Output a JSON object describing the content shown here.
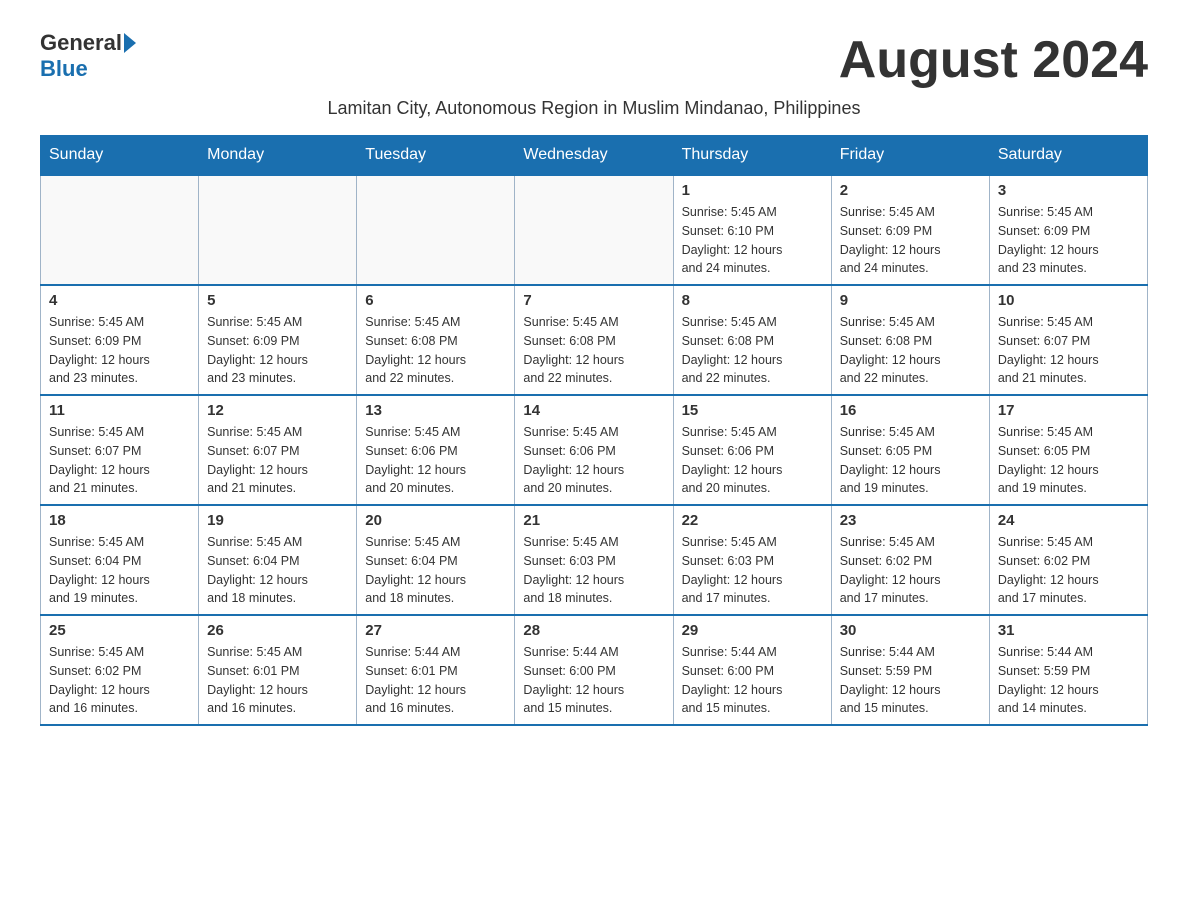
{
  "header": {
    "logo_general": "General",
    "logo_blue": "Blue",
    "month_title": "August 2024",
    "subtitle": "Lamitan City, Autonomous Region in Muslim Mindanao, Philippines"
  },
  "weekdays": [
    "Sunday",
    "Monday",
    "Tuesday",
    "Wednesday",
    "Thursday",
    "Friday",
    "Saturday"
  ],
  "weeks": [
    [
      {
        "day": "",
        "info": ""
      },
      {
        "day": "",
        "info": ""
      },
      {
        "day": "",
        "info": ""
      },
      {
        "day": "",
        "info": ""
      },
      {
        "day": "1",
        "info": "Sunrise: 5:45 AM\nSunset: 6:10 PM\nDaylight: 12 hours\nand 24 minutes."
      },
      {
        "day": "2",
        "info": "Sunrise: 5:45 AM\nSunset: 6:09 PM\nDaylight: 12 hours\nand 24 minutes."
      },
      {
        "day": "3",
        "info": "Sunrise: 5:45 AM\nSunset: 6:09 PM\nDaylight: 12 hours\nand 23 minutes."
      }
    ],
    [
      {
        "day": "4",
        "info": "Sunrise: 5:45 AM\nSunset: 6:09 PM\nDaylight: 12 hours\nand 23 minutes."
      },
      {
        "day": "5",
        "info": "Sunrise: 5:45 AM\nSunset: 6:09 PM\nDaylight: 12 hours\nand 23 minutes."
      },
      {
        "day": "6",
        "info": "Sunrise: 5:45 AM\nSunset: 6:08 PM\nDaylight: 12 hours\nand 22 minutes."
      },
      {
        "day": "7",
        "info": "Sunrise: 5:45 AM\nSunset: 6:08 PM\nDaylight: 12 hours\nand 22 minutes."
      },
      {
        "day": "8",
        "info": "Sunrise: 5:45 AM\nSunset: 6:08 PM\nDaylight: 12 hours\nand 22 minutes."
      },
      {
        "day": "9",
        "info": "Sunrise: 5:45 AM\nSunset: 6:08 PM\nDaylight: 12 hours\nand 22 minutes."
      },
      {
        "day": "10",
        "info": "Sunrise: 5:45 AM\nSunset: 6:07 PM\nDaylight: 12 hours\nand 21 minutes."
      }
    ],
    [
      {
        "day": "11",
        "info": "Sunrise: 5:45 AM\nSunset: 6:07 PM\nDaylight: 12 hours\nand 21 minutes."
      },
      {
        "day": "12",
        "info": "Sunrise: 5:45 AM\nSunset: 6:07 PM\nDaylight: 12 hours\nand 21 minutes."
      },
      {
        "day": "13",
        "info": "Sunrise: 5:45 AM\nSunset: 6:06 PM\nDaylight: 12 hours\nand 20 minutes."
      },
      {
        "day": "14",
        "info": "Sunrise: 5:45 AM\nSunset: 6:06 PM\nDaylight: 12 hours\nand 20 minutes."
      },
      {
        "day": "15",
        "info": "Sunrise: 5:45 AM\nSunset: 6:06 PM\nDaylight: 12 hours\nand 20 minutes."
      },
      {
        "day": "16",
        "info": "Sunrise: 5:45 AM\nSunset: 6:05 PM\nDaylight: 12 hours\nand 19 minutes."
      },
      {
        "day": "17",
        "info": "Sunrise: 5:45 AM\nSunset: 6:05 PM\nDaylight: 12 hours\nand 19 minutes."
      }
    ],
    [
      {
        "day": "18",
        "info": "Sunrise: 5:45 AM\nSunset: 6:04 PM\nDaylight: 12 hours\nand 19 minutes."
      },
      {
        "day": "19",
        "info": "Sunrise: 5:45 AM\nSunset: 6:04 PM\nDaylight: 12 hours\nand 18 minutes."
      },
      {
        "day": "20",
        "info": "Sunrise: 5:45 AM\nSunset: 6:04 PM\nDaylight: 12 hours\nand 18 minutes."
      },
      {
        "day": "21",
        "info": "Sunrise: 5:45 AM\nSunset: 6:03 PM\nDaylight: 12 hours\nand 18 minutes."
      },
      {
        "day": "22",
        "info": "Sunrise: 5:45 AM\nSunset: 6:03 PM\nDaylight: 12 hours\nand 17 minutes."
      },
      {
        "day": "23",
        "info": "Sunrise: 5:45 AM\nSunset: 6:02 PM\nDaylight: 12 hours\nand 17 minutes."
      },
      {
        "day": "24",
        "info": "Sunrise: 5:45 AM\nSunset: 6:02 PM\nDaylight: 12 hours\nand 17 minutes."
      }
    ],
    [
      {
        "day": "25",
        "info": "Sunrise: 5:45 AM\nSunset: 6:02 PM\nDaylight: 12 hours\nand 16 minutes."
      },
      {
        "day": "26",
        "info": "Sunrise: 5:45 AM\nSunset: 6:01 PM\nDaylight: 12 hours\nand 16 minutes."
      },
      {
        "day": "27",
        "info": "Sunrise: 5:44 AM\nSunset: 6:01 PM\nDaylight: 12 hours\nand 16 minutes."
      },
      {
        "day": "28",
        "info": "Sunrise: 5:44 AM\nSunset: 6:00 PM\nDaylight: 12 hours\nand 15 minutes."
      },
      {
        "day": "29",
        "info": "Sunrise: 5:44 AM\nSunset: 6:00 PM\nDaylight: 12 hours\nand 15 minutes."
      },
      {
        "day": "30",
        "info": "Sunrise: 5:44 AM\nSunset: 5:59 PM\nDaylight: 12 hours\nand 15 minutes."
      },
      {
        "day": "31",
        "info": "Sunrise: 5:44 AM\nSunset: 5:59 PM\nDaylight: 12 hours\nand 14 minutes."
      }
    ]
  ]
}
